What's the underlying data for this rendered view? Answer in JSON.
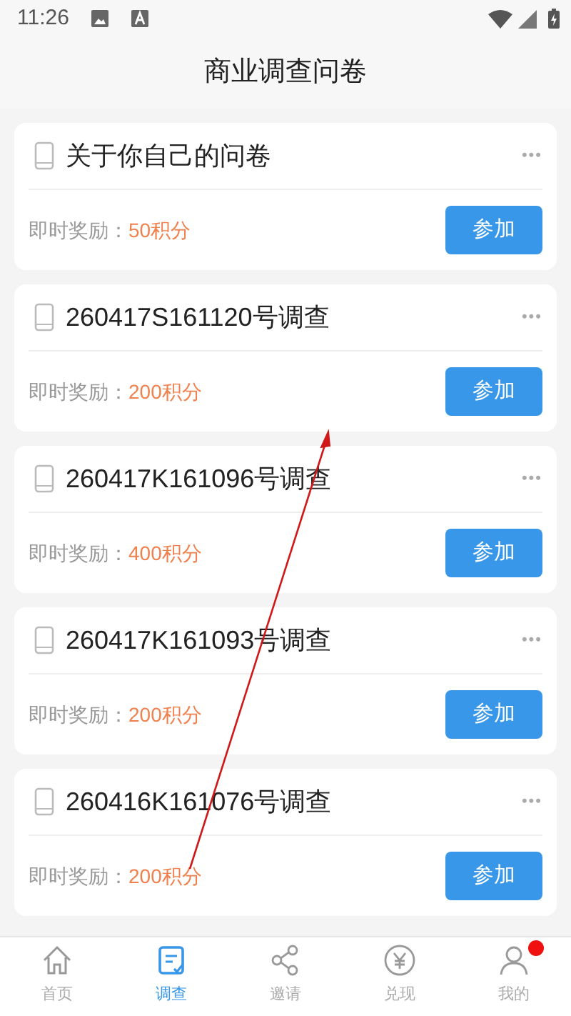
{
  "status_bar": {
    "time": "11:26"
  },
  "header": {
    "title": "商业调查问卷"
  },
  "surveys": [
    {
      "title": "关于你自己的问卷",
      "reward_label": "即时奖励：",
      "reward": "50积分",
      "button": "参加",
      "more": "•••"
    },
    {
      "title": "260417S161120号调查",
      "reward_label": "即时奖励：",
      "reward": "200积分",
      "button": "参加",
      "more": "•••"
    },
    {
      "title": "260417K161096号调查",
      "reward_label": "即时奖励：",
      "reward": "400积分",
      "button": "参加",
      "more": "•••"
    },
    {
      "title": "260417K161093号调查",
      "reward_label": "即时奖励：",
      "reward": "200积分",
      "button": "参加",
      "more": "•••"
    },
    {
      "title": "260416K161076号调查",
      "reward_label": "即时奖励：",
      "reward": "200积分",
      "button": "参加",
      "more": "•••"
    }
  ],
  "nav": [
    {
      "kind": "home",
      "label": "首页",
      "selected": false,
      "badge": false
    },
    {
      "kind": "survey",
      "label": "调查",
      "selected": true,
      "badge": false
    },
    {
      "kind": "share",
      "label": "邀请",
      "selected": false,
      "badge": false
    },
    {
      "kind": "yen",
      "label": "兑现",
      "selected": false,
      "badge": false
    },
    {
      "kind": "person",
      "label": "我的",
      "selected": false,
      "badge": true
    }
  ]
}
